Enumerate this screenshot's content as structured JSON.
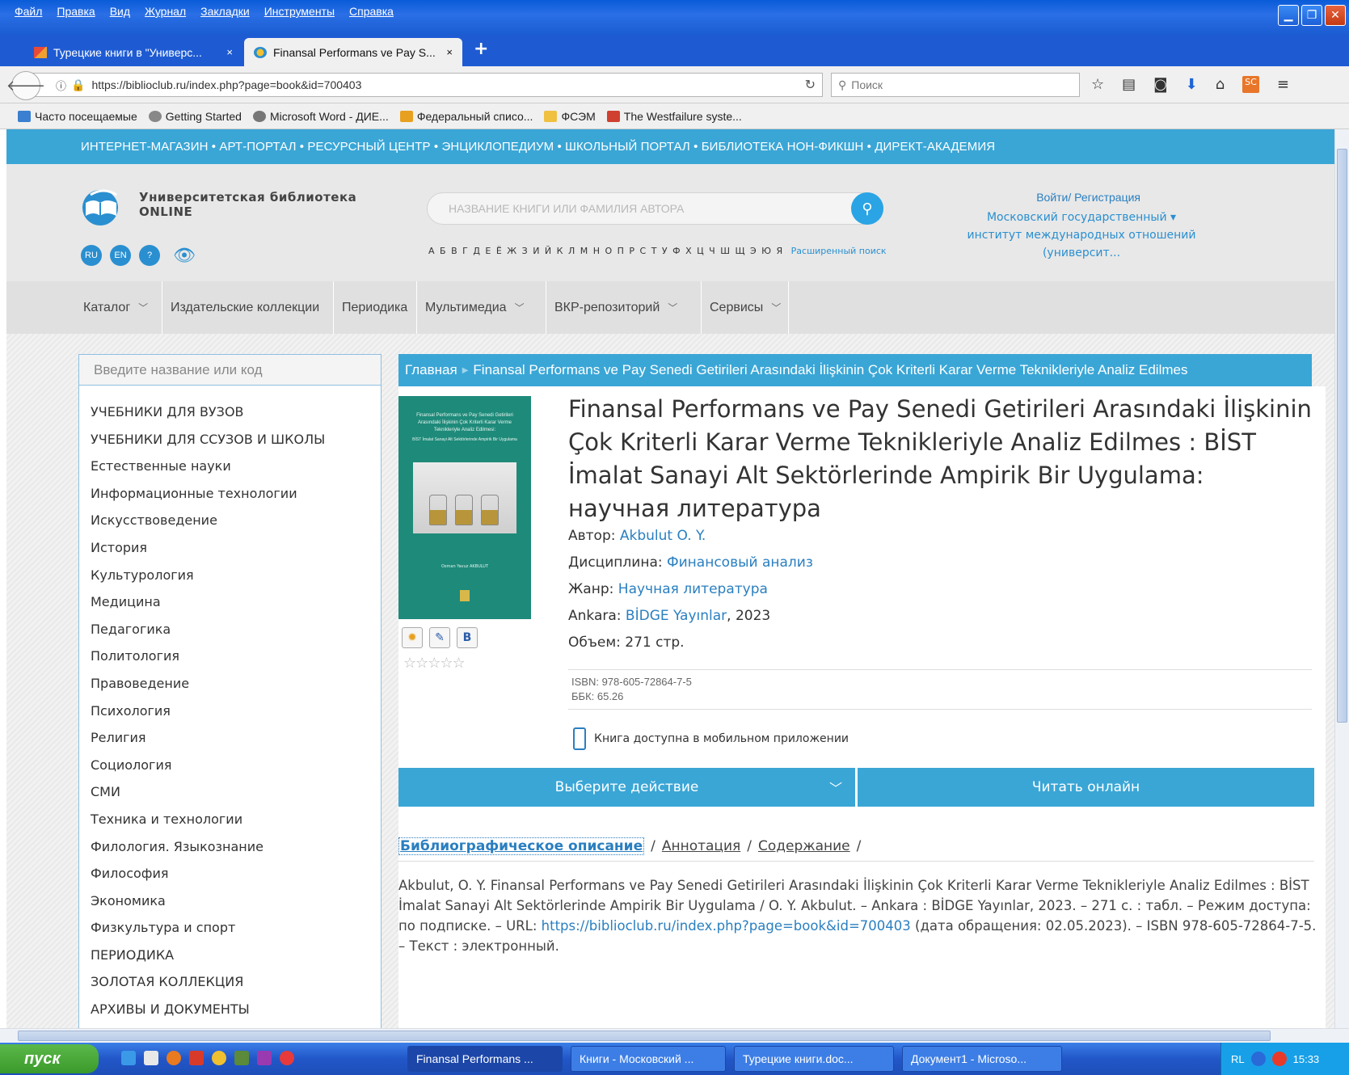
{
  "browser": {
    "menu": [
      "Файл",
      "Правка",
      "Вид",
      "Журнал",
      "Закладки",
      "Инструменты",
      "Справка"
    ],
    "tabs": [
      {
        "label": "Турецкие книги в \"Универс...",
        "close": "×"
      },
      {
        "label": "Finansal Performans ve Pay S...",
        "close": "×"
      }
    ],
    "new_tab": "+",
    "url": "https://biblioclub.ru/index.php?page=book&id=700403",
    "search_placeholder": "Поиск",
    "bookmarks": [
      "Часто посещаемые",
      "Getting Started",
      "Microsoft Word - ДИЕ...",
      "Федеральный списо...",
      "ФСЭМ",
      "The Westfailure syste..."
    ]
  },
  "site": {
    "portal_links": "ИНТЕРНЕТ-МАГАЗИН • АРТ-ПОРТАЛ • РЕСУРСНЫЙ ЦЕНТР • ЭНЦИКЛОПЕДИУМ • ШКОЛЬНЫЙ ПОРТАЛ • БИБЛИОТЕКА НОН-ФИКШН • ДИРЕКТ-АКАДЕМИЯ",
    "logo_line1": "Университетская библиотека",
    "logo_line2": "ONLINE",
    "lang": [
      "RU",
      "EN",
      "?"
    ],
    "search_placeholder": "НАЗВАНИЕ КНИГИ ИЛИ ФАМИЛИЯ АВТОРА",
    "alphabet": "А Б В Г Д Е Ё Ж З И Й К Л М Н О П Р С Т У Ф Х Ц Ч Ш Щ Э Ю Я",
    "advanced_search": "Расширенный поиск",
    "login": "Войти/ Регистрация",
    "org_line1": "Московский государственный ▾",
    "org_line2": "институт международных отношений",
    "org_line3": "(университ..."
  },
  "nav": [
    {
      "label": "Каталог",
      "dropdown": true
    },
    {
      "label": "Издательские коллекции",
      "dropdown": false
    },
    {
      "label": "Периодика",
      "dropdown": false
    },
    {
      "label": "Мультимедиа",
      "dropdown": true
    },
    {
      "label": "ВКР-репозиторий",
      "dropdown": true
    },
    {
      "label": "Сервисы",
      "dropdown": true
    }
  ],
  "sidebar": {
    "search_placeholder": "Введите название или код",
    "items": [
      "УЧЕБНИКИ ДЛЯ ВУЗОВ",
      "УЧЕБНИКИ ДЛЯ ССУЗОВ И ШКОЛЫ",
      "Естественные науки",
      "Информационные технологии",
      "Искусствоведение",
      "История",
      "Культурология",
      "Медицина",
      "Педагогика",
      "Политология",
      "Правоведение",
      "Психология",
      "Религия",
      "Социология",
      "СМИ",
      "Техника и технологии",
      "Филология. Языкознание",
      "Философия",
      "Экономика",
      "Физкультура и спорт",
      "ПЕРИОДИКА",
      "ЗОЛОТАЯ КОЛЛЕКЦИЯ",
      "АРХИВЫ И ДОКУМЕНТЫ"
    ]
  },
  "breadcrumb": {
    "home": "Главная",
    "current": "Finansal Performans ve Pay Senedi Getirileri Arasındaki İlişkinin Çok Kriterli Karar Verme Teknikleriyle Analiz Edilmes"
  },
  "book": {
    "cover_title": "Finansal Performans ve Pay Senedi Getirileri Arasındaki İlişkinin Çok Kriterli Karar Verme Teknikleriyle Analiz Edilmesi:",
    "cover_subtitle": "BİST İmalat Sanayi Alt Sektörlerinde Ampirik Bir Uygulama",
    "cover_author": "Osman Yavuz AKBULUT",
    "title": "Finansal Performans ve Pay Senedi Getirileri Arasındaki İlişkinin Çok Kriterli Karar Verme Teknikleriyle Analiz Edilmes : BİST İmalat Sanayi Alt Sektörlerinde Ampirik Bir Uygulama: научная литература",
    "author_label": "Автор:",
    "author": "Akbulut O. Y.",
    "discipline_label": "Дисциплина:",
    "discipline": "Финансовый анализ",
    "genre_label": "Жанр:",
    "genre": "Научная литература",
    "city": "Ankara:",
    "publisher": "BİDGE Yayınlar",
    "year": ", 2023",
    "volume": "Объем: 271 стр.",
    "isbn": "ISBN: 978-605-72864-7-5",
    "bbk": "ББК: 65.26",
    "mobile_note": "Книга доступна в мобильном приложении",
    "share_icons": [
      "bookmark-icon",
      "clip-icon",
      "vk-icon"
    ],
    "vk_letter": "B",
    "stars": "☆☆☆☆☆",
    "action_button": "Выберите действие",
    "read_button": "Читать онлайн",
    "tabs": [
      "Библиографическое описание",
      "Аннотация",
      "Содержание"
    ],
    "desc_part1": "Akbulut, O. Y. Finansal Performans ve Pay Senedi Getirileri Arasındaki İlişkinin Çok Kriterli Karar Verme Teknikleriyle Analiz Edilmes : BİST İmalat Sanayi Alt Sektörlerinde Ampirik Bir Uygulama / O. Y. Akbulut. – Ankara : BİDGE Yayınlar, 2023. – 271 с. : табл. – Режим доступа: по подписке. – URL: ",
    "desc_link": "https://biblioclub.ru/index.php?page=book&id=700403",
    "desc_part2": " (дата обращения: 02.05.2023). – ISBN 978-605-72864-7-5. – Текст : электронный."
  },
  "taskbar": {
    "start": "пуск",
    "tasks": [
      "Finansal Performans ...",
      "Книги - Московский ...",
      "Турецкие книги.doc...",
      "Документ1 - Microso..."
    ],
    "lang": "RL",
    "time": "15:33"
  }
}
